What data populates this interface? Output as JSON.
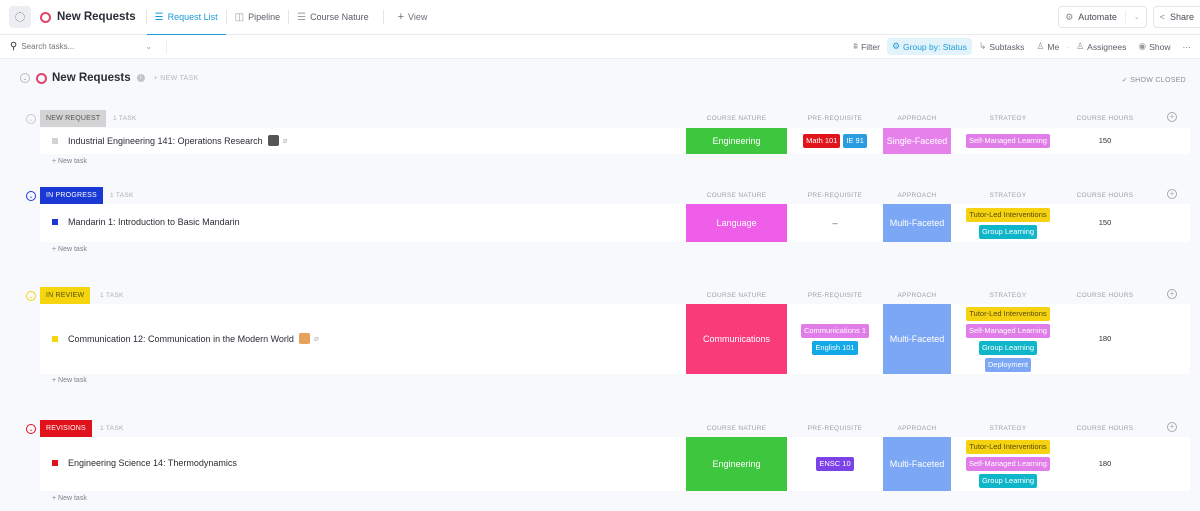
{
  "header": {
    "space_title": "New Requests",
    "tabs": [
      {
        "label": "Request List",
        "icon": "list-icon",
        "active": true
      },
      {
        "label": "Pipeline",
        "icon": "board-icon",
        "active": false
      },
      {
        "label": "Course Nature",
        "icon": "list-icon",
        "active": false
      }
    ],
    "add_view_label": "View",
    "automate_label": "Automate",
    "share_label": "Share"
  },
  "toolbar": {
    "search_placeholder": "Search tasks...",
    "filter_label": "Filter",
    "group_by_label": "Group by: Status",
    "subtasks_label": "Subtasks",
    "me_label": "Me",
    "assignees_label": "Assignees",
    "show_label": "Show",
    "more_label": "···"
  },
  "list": {
    "title": "New Requests",
    "new_task_label": "+ NEW TASK",
    "show_closed_label": "✓ SHOW CLOSED"
  },
  "columns": {
    "course_nature": "COURSE NATURE",
    "prerequisite": "PRE-REQUISITE",
    "approach": "APPROACH",
    "strategy": "STRATEGY",
    "course_hours": "COURSE HOURS"
  },
  "colors": {
    "accent": "#1c9bd8",
    "list_ring": "#e2446b"
  },
  "groups": [
    {
      "status": "NEW REQUEST",
      "status_color": "#d3d3d3",
      "status_text_color": "#555555",
      "task_count": "1 TASK",
      "new_task_label": "+ New task",
      "task": {
        "name": "Industrial Engineering 141: Operations Research",
        "square_color": "#d3d3d3",
        "has_thumbnail": true,
        "has_attachment": true,
        "course_nature": {
          "label": "Engineering",
          "color": "#3ec63e"
        },
        "prerequisites": [
          {
            "label": "Math 101",
            "color": "#e0151b"
          },
          {
            "label": "IE 91",
            "color": "#2a9de0"
          }
        ],
        "approach": {
          "label": "Single-Faceted",
          "color": "#e681ec"
        },
        "strategy": [
          {
            "label": "Self-Managed Learning",
            "color": "#e17de8"
          }
        ],
        "course_hours": "150"
      }
    },
    {
      "status": "IN PROGRESS",
      "status_color": "#1a39d4",
      "status_text_color": "#ffffff",
      "task_count": "1 TASK",
      "new_task_label": "+ New task",
      "task": {
        "name": "Mandarin 1: Introduction to Basic Mandarin",
        "square_color": "#1a39d4",
        "has_thumbnail": false,
        "has_attachment": false,
        "course_nature": {
          "label": "Language",
          "color": "#ee5ee8"
        },
        "prerequisites": [],
        "prerequisite_empty": "–",
        "approach": {
          "label": "Multi-Faceted",
          "color": "#7ba7f5"
        },
        "strategy": [
          {
            "label": "Tutor-Led Interventions",
            "color": "#f5d313"
          },
          {
            "label": "Group Learning",
            "color": "#0fb5c9"
          }
        ],
        "course_hours": "150"
      }
    },
    {
      "status": "IN REVIEW",
      "status_color": "#f5d60e",
      "status_text_color": "#5a5000",
      "task_count": "1 TASK",
      "new_task_label": "+ New task",
      "task": {
        "name": "Communication 12: Communication in the Modern World",
        "square_color": "#f5d60e",
        "has_thumbnail": true,
        "has_attachment": true,
        "course_nature": {
          "label": "Communications",
          "color": "#fa3b7a"
        },
        "prerequisites": [
          {
            "label": "Communications 1",
            "color": "#e17de8"
          },
          {
            "label": "English 101",
            "color": "#13a8e6"
          }
        ],
        "approach": {
          "label": "Multi-Faceted",
          "color": "#7ba7f5"
        },
        "strategy": [
          {
            "label": "Tutor-Led Interventions",
            "color": "#f5d313"
          },
          {
            "label": "Self-Managed Learning",
            "color": "#e17de8"
          },
          {
            "label": "Group Learning",
            "color": "#0fb5c9"
          },
          {
            "label": "Deployment",
            "color": "#7ba7f5"
          }
        ],
        "course_hours": "180"
      }
    },
    {
      "status": "REVISIONS",
      "status_color": "#e0111a",
      "status_text_color": "#ffffff",
      "task_count": "1 TASK",
      "new_task_label": "+ New task",
      "task": {
        "name": "Engineering Science 14: Thermodynamics",
        "square_color": "#e0111a",
        "has_thumbnail": false,
        "has_attachment": false,
        "course_nature": {
          "label": "Engineering",
          "color": "#3ec63e"
        },
        "prerequisites": [
          {
            "label": "ENSC 10",
            "color": "#7b42e8"
          }
        ],
        "approach": {
          "label": "Multi-Faceted",
          "color": "#7ba7f5"
        },
        "strategy": [
          {
            "label": "Tutor-Led Interventions",
            "color": "#f5d313"
          },
          {
            "label": "Self-Managed Learning",
            "color": "#e17de8"
          },
          {
            "label": "Group Learning",
            "color": "#0fb5c9"
          }
        ],
        "course_hours": "180"
      }
    }
  ]
}
